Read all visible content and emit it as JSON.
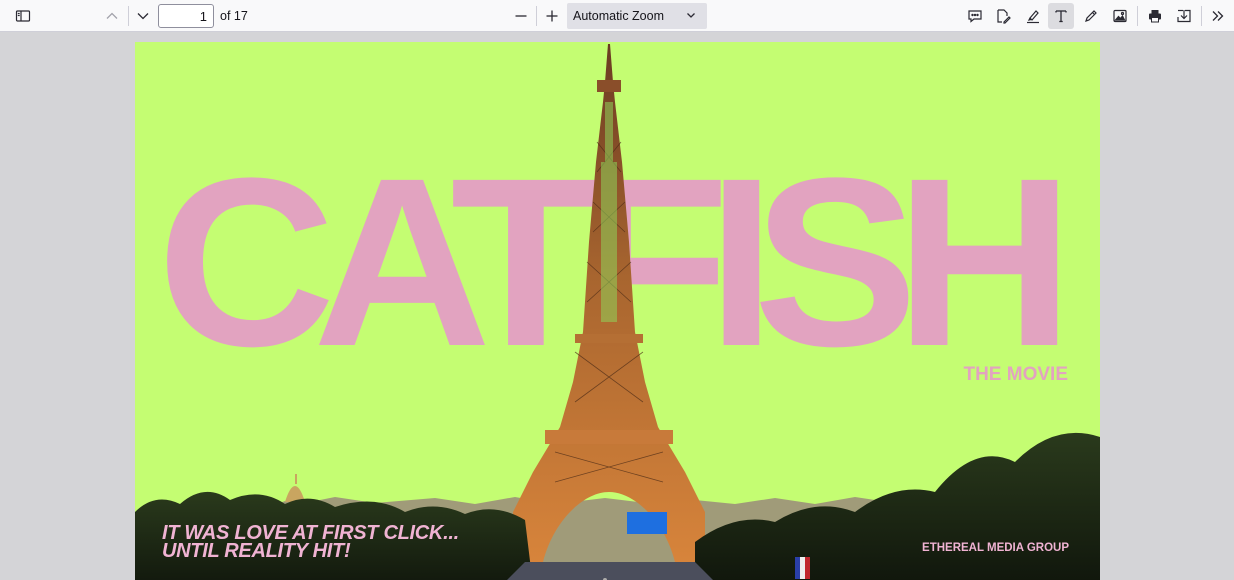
{
  "toolbar": {
    "page_number": "1",
    "page_count_label": "of 17",
    "zoom_value": "Automatic Zoom",
    "icons": [
      "sidebar-toggle-icon",
      "page-up-icon",
      "page-down-icon",
      "zoom-out-icon",
      "zoom-in-icon",
      "comment-icon",
      "signature-icon",
      "highlight-icon",
      "text-icon",
      "draw-icon",
      "image-icon",
      "print-icon",
      "save-icon",
      "more-tools-icon"
    ],
    "active_tool": "text"
  },
  "document": {
    "background_color": "#c4fd72",
    "title": "CATFISH",
    "title_color": "#e2a3c0",
    "subtitle": "THE MOVIE",
    "tagline_line1": "IT WAS LOVE AT FIRST CLICK...",
    "tagline_line2": "UNTIL REALITY HIT!",
    "company": "ETHEREAL MEDIA GROUP",
    "image_subject": "eiffel-tower"
  }
}
